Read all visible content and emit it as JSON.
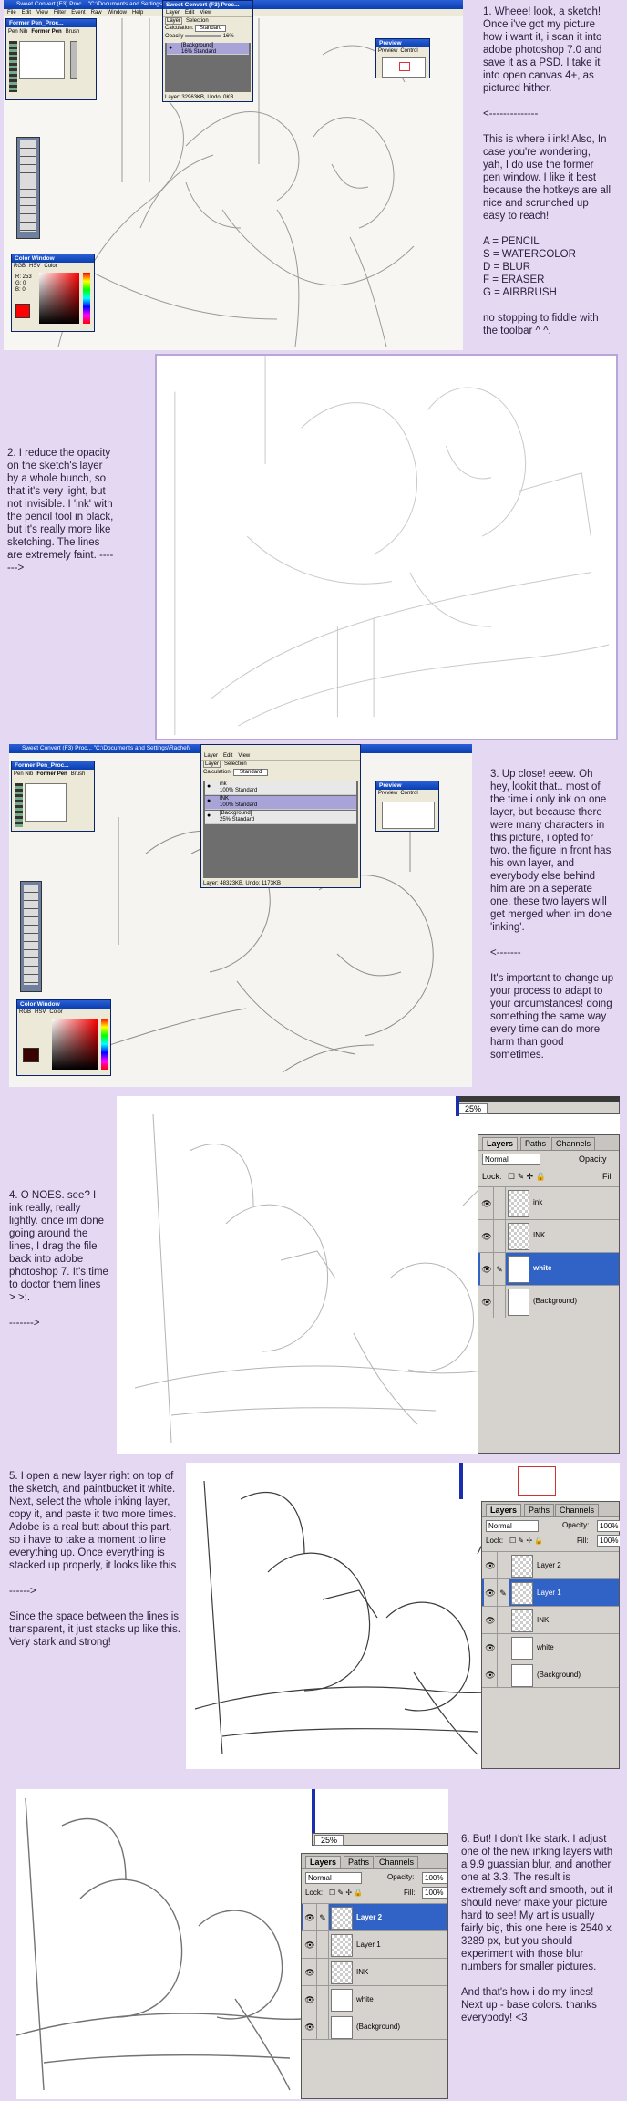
{
  "notes": {
    "n1": "1. Wheee! look, a sketch! Once i've got my picture how i want it, i scan it into adobe photoshop 7.0 and save it as a PSD. I take it into open canvas 4+, as pictured hither.\n\n<--------------\n\nThis is where i ink! Also, In case you're wondering, yah, I do use the former pen window. I like it best because the hotkeys are all nice and scrunched up easy to reach!\n\nA = PENCIL\nS = WATERCOLOR\nD = BLUR\nF = ERASER\nG = AIRBRUSH\n\nno stopping to fiddle with the toolbar ^ ^.",
    "n2": "2. I reduce the opacity on the sketch's layer by a whole bunch, so that it's very light, but not invisible. I 'ink' with the pencil tool in black, but it's really more like sketching. The lines are extremely faint. ------->",
    "n3": "3. Up close! eeew.  Oh hey, lookit that.. most of the time i only ink on one layer, but because there were many characters in this picture, i opted for two. the figure in front has his own layer, and everybody else behind him are on a seperate one. these two layers will get merged when im done 'inking'.\n\n<-------\n\nIt's important to change up your process to adapt to your circumstances! doing something the same way every time can do more harm than good sometimes.",
    "n4": "4. O NOES. see? I ink really, really lightly. once im done going around the lines, I drag the file back into adobe photoshop 7. It's time to doctor them lines > >;.\n\n------->",
    "n5": "5. I open a new layer right on top of the sketch, and paintbucket it white. Next, select the whole inking layer, copy it, and paste it two more times. Adobe is a real butt about this part, so i have to take a moment to line everything up. Once everything is stacked up properly, it looks like this\n\n------>\n\nSince the space between the lines is transparent, it just stacks up like this. Very stark and strong!",
    "n6": "6. But! I don't like stark. I adjust one of the new inking layers with a 9.9 guassian blur, and another one at 3.3. The result is extremely soft and smooth, but it should never make your picture hard to see! My art is usually fairly big, this one here is 2540 x 3289 px, but you should experiment with those blur numbers for smaller pictures.\n\nAnd that's how i do my lines! Next up - base colors. thanks everybody! <3"
  },
  "oc1": {
    "main_title": "Sweet Convert (F3) Proc... \"C:\\Documents and Settings\\Rach",
    "menu": [
      "File",
      "Edit",
      "View",
      "Filter",
      "Event",
      "Raw",
      "Window",
      "Help"
    ],
    "pen_title": "Former Pen_Proc...",
    "pen_tabs": [
      "Pen Nib",
      "Former Pen",
      "Brush"
    ],
    "layer_title": "Sweet Convert (F3) Proc...",
    "layer_menu": [
      "Layer",
      "Edit",
      "View"
    ],
    "layer_tabs": [
      "Layer",
      "Selection"
    ],
    "calc_label": "Calculation:",
    "calc_value": "Standard",
    "opacity_label": "Opacity",
    "opacity_value": "16%",
    "layer_name": "[Background]",
    "layer_info": "16% Standard",
    "layer_status": "Layer: 32963KB, Undo: 0KB",
    "preview_title": "Preview",
    "preview_tabs": [
      "Preview",
      "Control"
    ],
    "color_title": "Color Window",
    "color_tabs": [
      "RGB",
      "HSV",
      "Color"
    ],
    "rgb": [
      "R: 253",
      "G: 0",
      "B: 0"
    ]
  },
  "oc2": {
    "main_title": "Sweet Convert (F3) Proc... \"C:\\Documents and Settings\\Rachel\\",
    "pen_title": "Former Pen_Proc...",
    "pen_tabs": [
      "Pen Nib",
      "Former Pen",
      "Brush"
    ],
    "layer_menu": [
      "Layer",
      "Edit",
      "View"
    ],
    "layer_tabs": [
      "Layer",
      "Selection"
    ],
    "calc_label": "Calculation:",
    "calc_value": "Standard",
    "layers": [
      {
        "name": "ink",
        "info": "100% Standard"
      },
      {
        "name": "INK",
        "info": "100% Standard"
      },
      {
        "name": "[Background]",
        "info": "25% Standard"
      }
    ],
    "layer_status": "Layer: 48323KB, Undo: 1173KB",
    "preview_title": "Preview",
    "preview_tabs": [
      "Preview",
      "Control"
    ],
    "color_title": "Color Window",
    "color_tabs": [
      "RGB",
      "HSV",
      "Color"
    ]
  },
  "ps4": {
    "zoom": "25%",
    "tabs": [
      "Layers",
      "Paths",
      "Channels"
    ],
    "blend": "Normal",
    "opacity_label": "Opacity",
    "lock_label": "Lock:",
    "fill_label": "Fill",
    "layers": [
      "ink",
      "INK",
      "white",
      "(Background)"
    ]
  },
  "ps5": {
    "tabs": [
      "Layers",
      "Paths",
      "Channels"
    ],
    "blend": "Normal",
    "opacity_label": "Opacity:",
    "opacity_value": "100%",
    "lock_label": "Lock:",
    "fill_label": "Fill:",
    "fill_value": "100%",
    "layers": [
      "Layer 2",
      "Layer 1",
      "INK",
      "white",
      "(Background)"
    ]
  },
  "ps6": {
    "zoom": "25%",
    "tabs": [
      "Layers",
      "Paths",
      "Channels"
    ],
    "blend": "Normal",
    "opacity_label": "Opacity:",
    "opacity_value": "100%",
    "lock_label": "Lock:",
    "fill_label": "Fill:",
    "fill_value": "100%",
    "layers": [
      "Layer 2",
      "Layer 1",
      "INK",
      "white",
      "(Background)"
    ]
  }
}
